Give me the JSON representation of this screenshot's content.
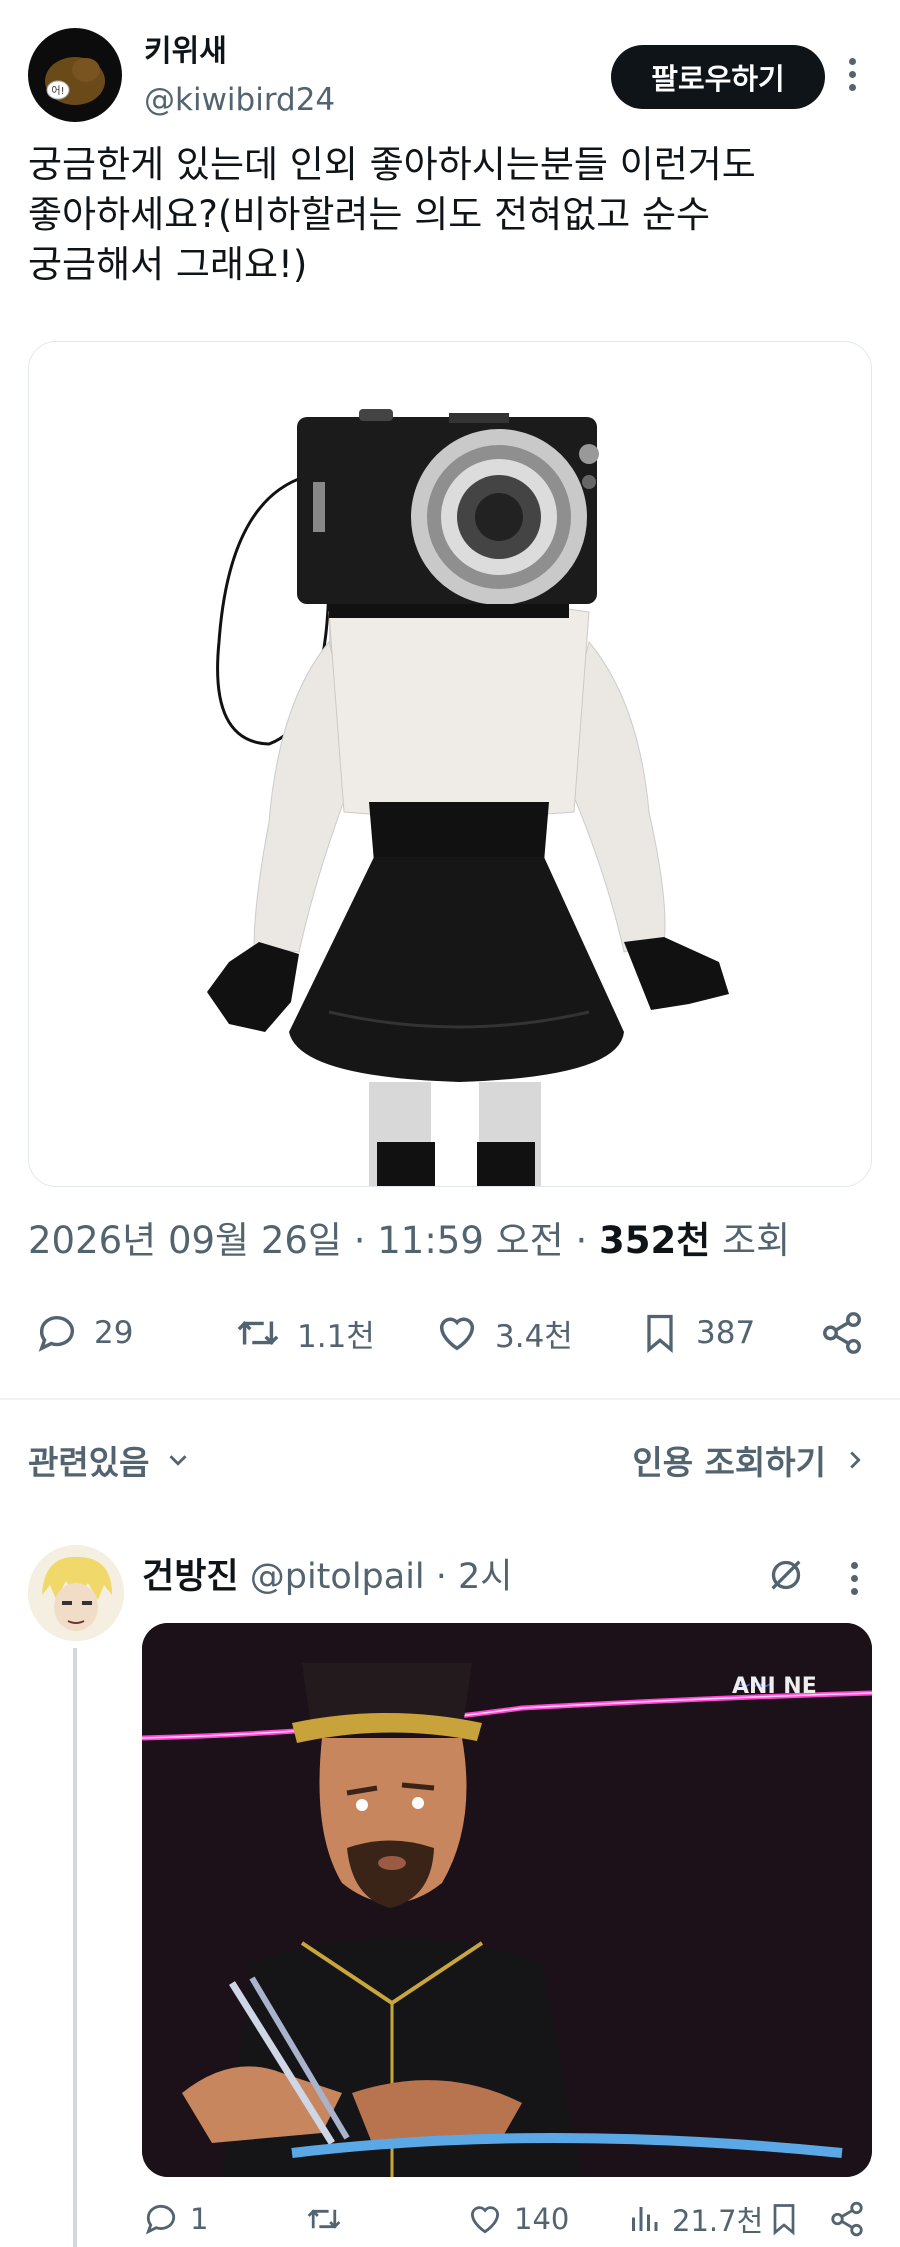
{
  "author": {
    "display_name": "키위새",
    "handle": "@kiwibird24",
    "avatar_text": "어!"
  },
  "follow_label": "팔로우하기",
  "tweet_text": "궁금한게 있는데 인외 좋아하시는분들 이런거도\n좋아하세요?(비하할려는 의도 전혀없고 순수\n궁금해서 그래요!)",
  "meta": {
    "datetime": "2026년 09월 26일 · 11:59 오전 · ",
    "views_count": "352천",
    "views_label": " 조회"
  },
  "actions": {
    "replies": "29",
    "retweets": "1.1천",
    "likes": "3.4천",
    "bookmarks": "387"
  },
  "related_label": "관련있음",
  "quotes_label": "인용 조회하기",
  "reply": {
    "name": "건방진",
    "handle": " @pitolpail",
    "time": " · 2시",
    "media_watermark": "ANI NE",
    "replies": "1",
    "retweets": "",
    "likes": "140",
    "views": "21.7천"
  },
  "colors": {
    "text": "#0f1419",
    "secondary": "#536471",
    "divider": "#eff3f4",
    "follow_bg": "#0f1419"
  }
}
